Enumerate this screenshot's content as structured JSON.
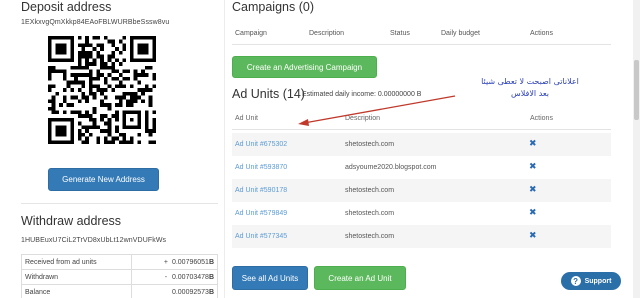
{
  "deposit": {
    "title": "Deposit address",
    "address": "1EXkxvgQmXkkp84EAoFBLWURBbeSssw8vu",
    "generate_label": "Generate New Address"
  },
  "withdraw": {
    "title": "Withdraw address",
    "address": "1HUBEuxU7CiL2TrVD8xUbLt12wnVDUFkWs"
  },
  "balances": [
    {
      "label": "Received from ad units",
      "sign": "+",
      "value": "0.00796051",
      "unit": "B"
    },
    {
      "label": "Withdrawn",
      "sign": "-",
      "value": "0.00703478",
      "unit": "B"
    },
    {
      "label": "Balance",
      "sign": "",
      "value": "0.00092573",
      "unit": "B"
    }
  ],
  "campaigns": {
    "title": "Campaigns (0)",
    "columns": [
      "Campaign",
      "Description",
      "Status",
      "Daily budget",
      "Actions"
    ],
    "create_label": "Create an Advertising Campaign"
  },
  "ad_units": {
    "title": "Ad Units (14)",
    "income_label": "Estimated daily income: 0.00000000 B",
    "columns": [
      "Ad Unit",
      "Description",
      "Actions"
    ],
    "rows": [
      {
        "id": "Ad Unit #675302",
        "description": "shetostech.com"
      },
      {
        "id": "Ad Unit #593870",
        "description": "adsyoume2020.blogspot.com"
      },
      {
        "id": "Ad Unit #590178",
        "description": "shetostech.com"
      },
      {
        "id": "Ad Unit #579849",
        "description": "shetostech.com"
      },
      {
        "id": "Ad Unit #577345",
        "description": "shetostech.com"
      }
    ],
    "see_all_label": "See all Ad Units",
    "create_label": "Create an Ad Unit",
    "delete_icon": "✖"
  },
  "annotation": {
    "line1": "اعلاناتى اصبحت لا تعطى شيئا",
    "line2": "بعد الافلاس",
    "color": "#2a3fb8"
  },
  "support": {
    "label": "Support",
    "icon": "?"
  },
  "colors": {
    "primary": "#337ab7",
    "success": "#5cb85c",
    "link": "#5b9bd5"
  }
}
